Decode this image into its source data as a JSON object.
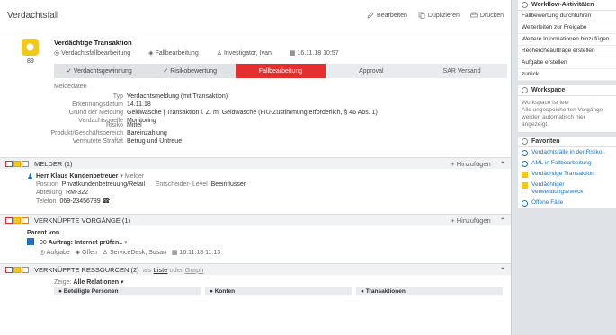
{
  "header": {
    "title": "Verdachtsfall",
    "edit_label": "Bearbeiten",
    "duplicate_label": "Duplizieren",
    "print_label": "Drucken"
  },
  "case": {
    "title": "Verdächtige Transaktion",
    "score": "89",
    "type": "Verdachtsfallbearbeitung",
    "stage": "Fallbearbeitung",
    "role": "Investigator, Ivan",
    "date": "16.11.18 10:57"
  },
  "steps": [
    "Verdachtsgewinnung",
    "Risikobewertung",
    "Fallbearbeitung",
    "Approval",
    "SAR Versand"
  ],
  "metadata": {
    "label": "Meldedaten",
    "rows": [
      {
        "k": "Typ",
        "v": "Verdachtsmeldung (mit Transaktion)"
      },
      {
        "k": "Erkennungsdatum",
        "v": "14.11.18"
      },
      {
        "k": "Grund der Meldung",
        "v": "Geldwäsche | Transaktion i. Z. m. Geldwäsche (FIU-Zustimmung erforderlich, § 46 Abs. 1)"
      },
      {
        "k": "Verdachtsquelle",
        "v": "Monitoring"
      }
    ],
    "rows2": [
      {
        "k": "Risiko",
        "v": "Mittel"
      },
      {
        "k": "Produkt/Geschäftsbereich",
        "v": "Bareinzahlung"
      },
      {
        "k": "Vermutete Straftat",
        "v": "Betrug und Untreue"
      }
    ]
  },
  "melder": {
    "section_title": "MELDER (1)",
    "add_label": "Hinzufügen",
    "name": "Herr Klaus Kundenbetreuer",
    "role": "Melder",
    "position_label": "Position",
    "position": "Privatkundenbetreuung/Retail",
    "level_label": "Entscheider- Level",
    "level": "Beeinflusser",
    "dept_label": "Abteilung",
    "dept": "RM-322",
    "phone_label": "Telefon",
    "phone": "069-23456789"
  },
  "vorgaenge": {
    "section_title": "VERKNÜPFTE VORGÄNGE (1)",
    "add_label": "Hinzufügen",
    "parent_label": "Parent von",
    "item_num": "90",
    "item_title": "Auftrag: Internet prüfen..",
    "item_type": "Aufgabe",
    "item_status": "Offen",
    "item_owner": "ServiceDesk, Susan",
    "item_date": "16.11.18 11:13"
  },
  "ressourcen": {
    "section_title": "VERKNÜPFTE RESSOURCEN (2)",
    "as_label": "als",
    "list_label": "Liste",
    "or_label": "oder",
    "graph_label": "Graph",
    "show_prefix": "Zeige:",
    "show_value": "Alle Relationen",
    "tabs": [
      "Beteiligte Personen",
      "Konten",
      "Transaktionen"
    ]
  },
  "workflow": {
    "title": "Workflow-Aktivitäten",
    "items": [
      "Fallbewertung durchführen",
      "Weiterleiten zur Freigabe",
      "Weitere Informationen hinzufügen",
      "Recherche­aufträge erstellen",
      "Aufgabe erstellen",
      "zurück"
    ]
  },
  "workspace": {
    "title": "Workspace",
    "text": "Workspace ist leer\nAlle ungespeicherten Vorgänge werden automatisch hier angezeigt."
  },
  "favorites": {
    "title": "Favoriten",
    "items": [
      "Verdachtsfälle in der Risiko..",
      "AML in Fallbearbeitung",
      "Verdächtige Transaktion",
      "Verdächtiger Verwendungszweck",
      "Offene Fälle"
    ]
  }
}
